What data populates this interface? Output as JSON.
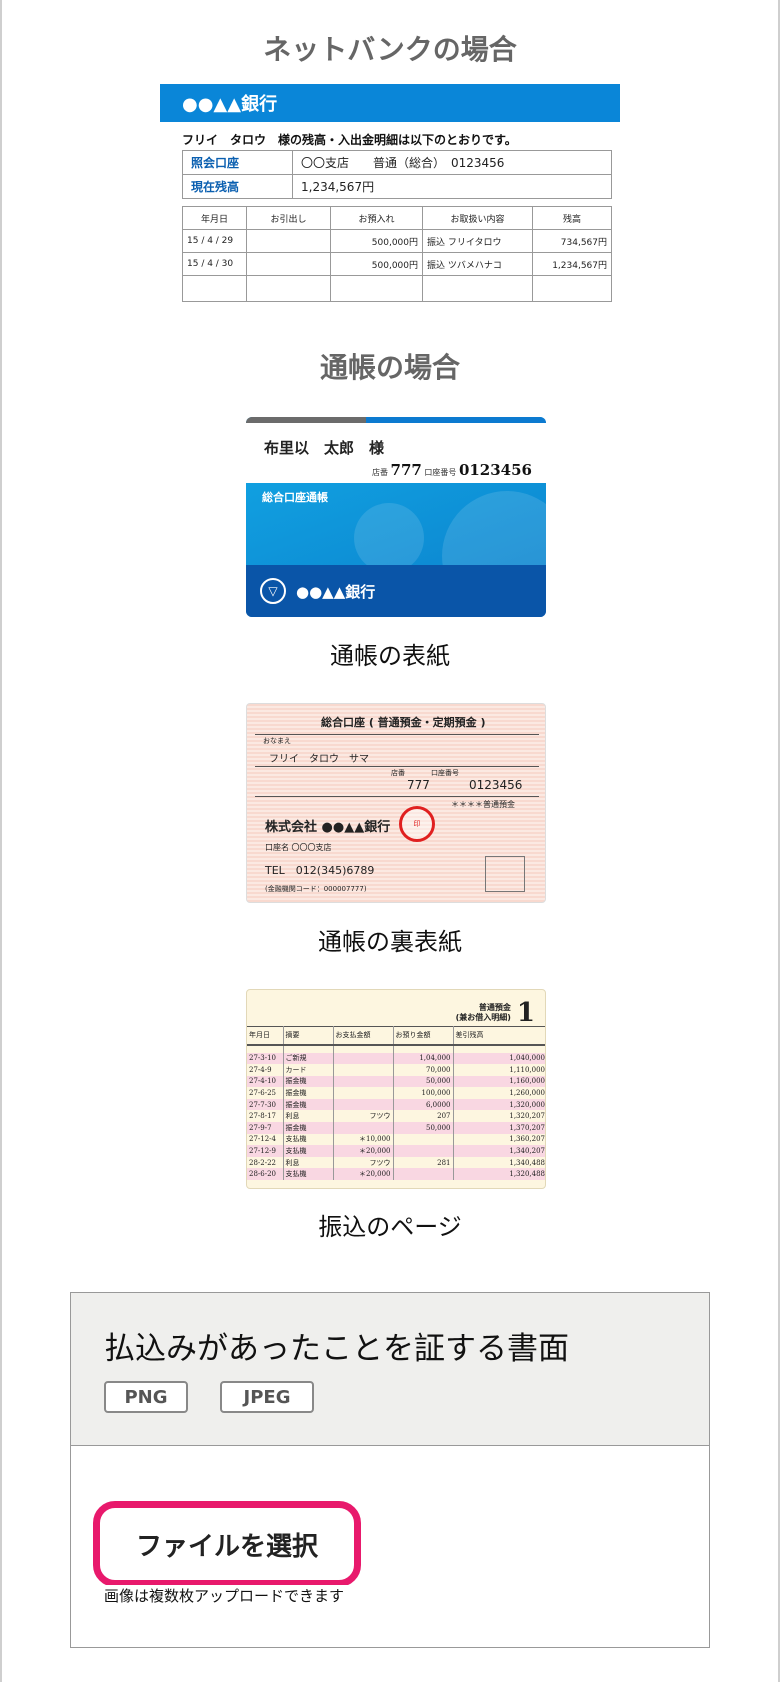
{
  "netbank": {
    "section_title": "ネットバンクの場合",
    "bank_name": "●●▲▲銀行",
    "message": "フリイ　タロウ　様の残高・入出金明細は以下のとおりです。",
    "account_label": "照会口座",
    "account_value": "〇〇支店　　普通（総合）　0123456",
    "balance_label": "現在残高",
    "balance_value": "1,234,567円",
    "columns": [
      "年月日",
      "お引出し",
      "お預入れ",
      "お取扱い内容",
      "残高"
    ],
    "rows": [
      [
        "15 / 4 / 29",
        "",
        "500,000円",
        "振込 フリイタロウ",
        "734,567円"
      ],
      [
        "15 / 4 / 30",
        "",
        "500,000円",
        "振込 ツバメハナコ",
        "1,234,567円"
      ]
    ]
  },
  "passbook": {
    "section_title": "通帳の場合",
    "cover": {
      "holder_name": "布里以　太郎　様",
      "branch_label": "店番",
      "branch_no": "777",
      "account_label": "口座番号",
      "account_no": "0123456",
      "product": "総合口座通帳",
      "bank_name": "●●▲▲銀行",
      "caption": "通帳の表紙"
    },
    "back_cover": {
      "title": "総合口座 ( 普通預金・定期預金 )",
      "name_label": "おなまえ",
      "name": "フリイ　タロウ　サマ",
      "branch_label": "店番",
      "branch_no": "777",
      "account_label": "口座番号",
      "account_no": "0123456",
      "type": "＊＊＊＊普通預金",
      "company": "株式会社 ●●▲▲銀行",
      "branch_name": "口座名 〇〇〇支店",
      "tel": "TEL　012(345)6789",
      "code": "(金融機関コード：000007777)",
      "caption": "通帳の裏表紙"
    },
    "transfer_page": {
      "header": "普通預金\n(兼お借入明細)",
      "page_no": "1",
      "columns": [
        "年月日",
        "摘要",
        "お支払金額",
        "お預り金額",
        "差引残高"
      ],
      "rows": [
        [
          "27-3-10",
          "ご新規",
          "",
          "1,04,000",
          "1,040,000"
        ],
        [
          "27-4-9",
          "カード",
          "",
          "70,000",
          "1,110,000"
        ],
        [
          "27-4-10",
          "振金機",
          "",
          "50,000",
          "1,160,000"
        ],
        [
          "27-6-25",
          "振金機",
          "",
          "100,000",
          "1,260,000"
        ],
        [
          "27-7-30",
          "振金機",
          "",
          "6,0000",
          "1,320,000"
        ],
        [
          "27-8-17",
          "利息",
          "フツウ",
          "207",
          "1,320,207"
        ],
        [
          "27-9-7",
          "振金機",
          "",
          "50,000",
          "1,370,207"
        ],
        [
          "27-12-4",
          "支払機",
          "＊10,000",
          "",
          "1,360,207"
        ],
        [
          "27-12-9",
          "支払機",
          "＊20,000",
          "",
          "1,340,207"
        ],
        [
          "28-2-22",
          "利息",
          "フツウ",
          "281",
          "1,340,488"
        ],
        [
          "28-6-20",
          "支払機",
          "＊20,000",
          "",
          "1,320,488"
        ]
      ],
      "caption": "振込のページ"
    }
  },
  "upload": {
    "title": "払込みがあったことを証する書面",
    "formats": [
      "PNG",
      "JPEG"
    ],
    "button_label": "ファイルを選択",
    "note": "画像は複数枚アップロードできます"
  }
}
